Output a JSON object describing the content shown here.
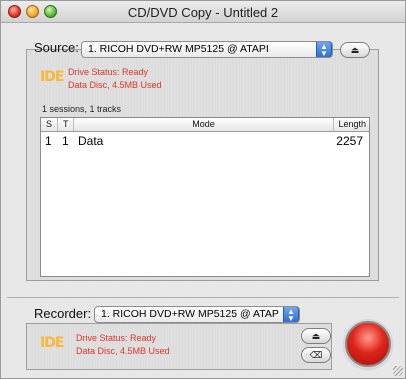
{
  "window": {
    "title": "CD/DVD Copy - Untitled 2"
  },
  "source": {
    "label": "Source:",
    "drive": "1. RICOH DVD+RW MP5125 @ ATAPI",
    "ide": "IDE",
    "status_line1": "Drive Status: Ready",
    "status_line2": "Data Disc, 4.5MB Used",
    "eject_icon": "eject-icon"
  },
  "disc": {
    "summary": "1 sessions, 1 tracks",
    "columns": [
      "S",
      "T",
      "Mode",
      "Length"
    ],
    "rows": [
      {
        "s": "1",
        "t": "1",
        "mode": "Data",
        "length": "2257"
      }
    ]
  },
  "recorder": {
    "label": "Recorder:",
    "drive": "1. RICOH DVD+RW MP5125 @ ATAP",
    "ide": "IDE",
    "status_line1": "Drive Status: Ready",
    "status_line2": "Data Disc, 4.5MB Used",
    "eject_icon": "eject-icon",
    "erase_icon": "erase-icon",
    "record_color": "#e0251b"
  }
}
